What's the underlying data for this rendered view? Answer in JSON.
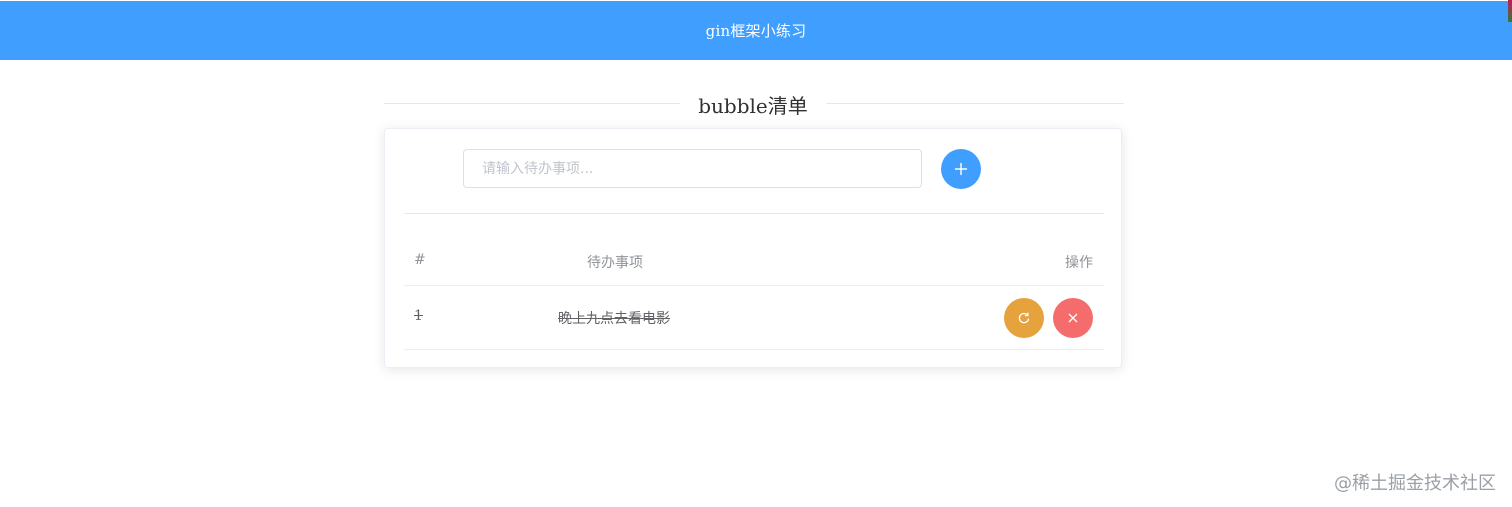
{
  "header": {
    "title": "gin框架小练习"
  },
  "section": {
    "title": "bubble清单"
  },
  "new_todo": {
    "placeholder": "请输入待办事项...",
    "add_icon": "plus-icon",
    "accent": "#409eff"
  },
  "table": {
    "columns": [
      "#",
      "待办事项",
      "操作"
    ],
    "rows": [
      {
        "index": "1",
        "title": "晚上九点去看电影",
        "done": true,
        "actions": [
          {
            "icon": "redo-icon",
            "color": "#e6a23c"
          },
          {
            "icon": "close-icon",
            "color": "#f56c6c"
          }
        ]
      }
    ]
  },
  "watermark": "@稀土掘金技术社区"
}
